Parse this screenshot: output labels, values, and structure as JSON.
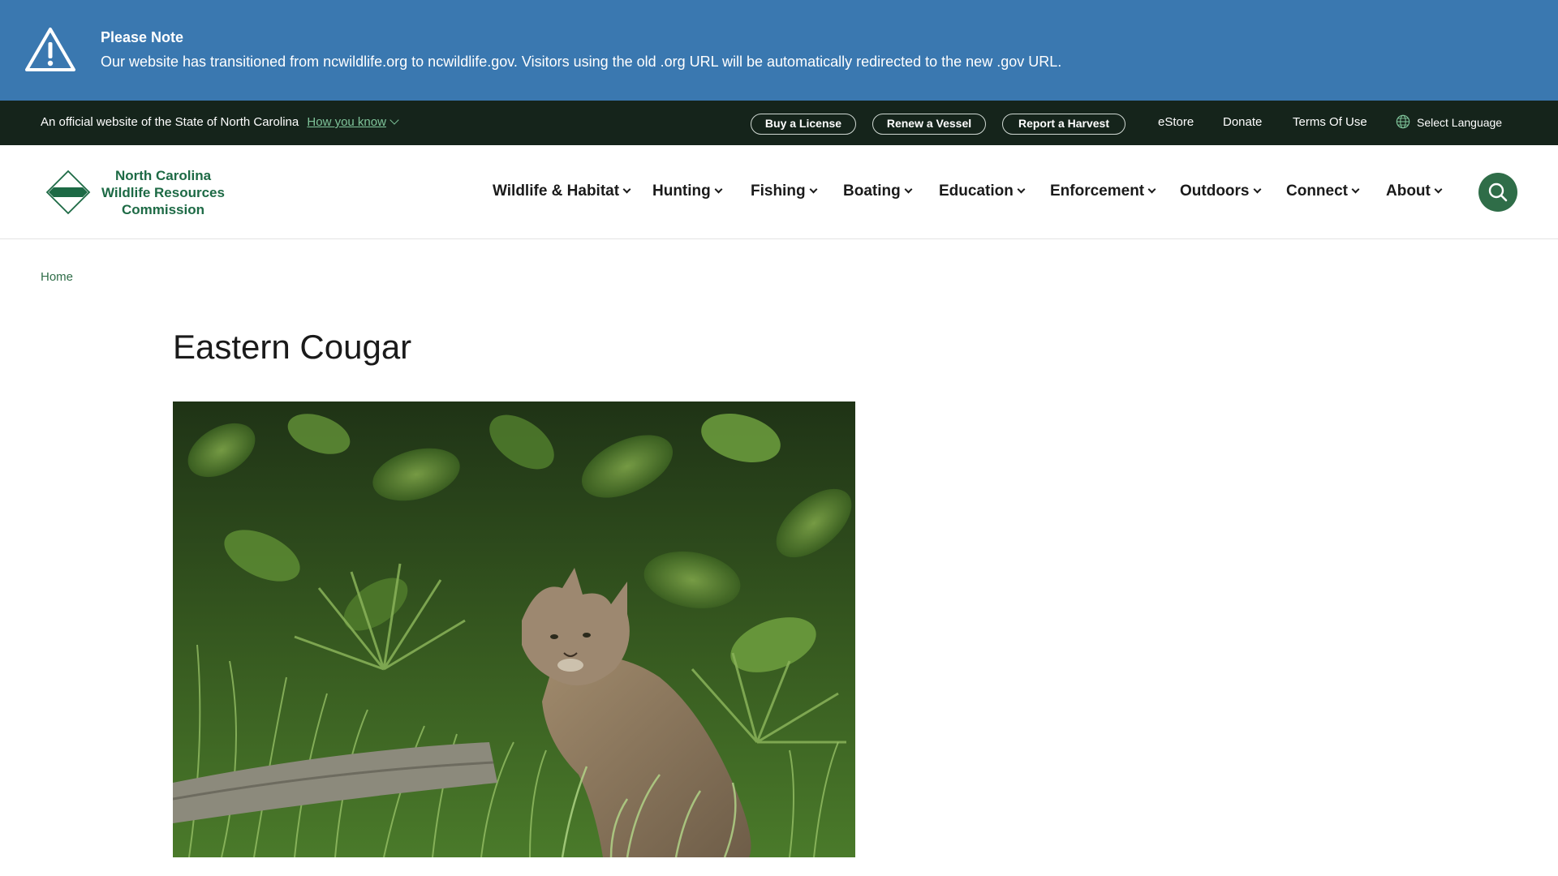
{
  "alert": {
    "title": "Please Note",
    "message": "Our website has transitioned from ncwildlife.org to ncwildlife.gov. Visitors using the old .org URL will be automatically redirected to the new .gov URL.",
    "icon": "warning-triangle-icon",
    "background": "#3a78b0"
  },
  "utility": {
    "official_text": "An official website of the State of North Carolina",
    "how_you_know": "How you know",
    "buttons": [
      "Buy a License",
      "Renew a Vessel",
      "Report a Harvest"
    ],
    "links": [
      "eStore",
      "Donate",
      "Terms Of Use"
    ],
    "language": "Select Language",
    "background": "#15241b"
  },
  "header": {
    "logo_lines": [
      "North Carolina",
      "Wildlife Resources",
      "Commission"
    ],
    "nav": [
      "Wildlife & Habitat",
      "Hunting",
      "Fishing",
      "Boating",
      "Education",
      "Enforcement",
      "Outdoors",
      "Connect",
      "About"
    ],
    "search_icon": "search-icon",
    "brand_color": "#2f6d48"
  },
  "breadcrumb": {
    "home": "Home"
  },
  "main": {
    "title": "Eastern Cougar",
    "image_subject": "cougar-in-vegetation"
  }
}
